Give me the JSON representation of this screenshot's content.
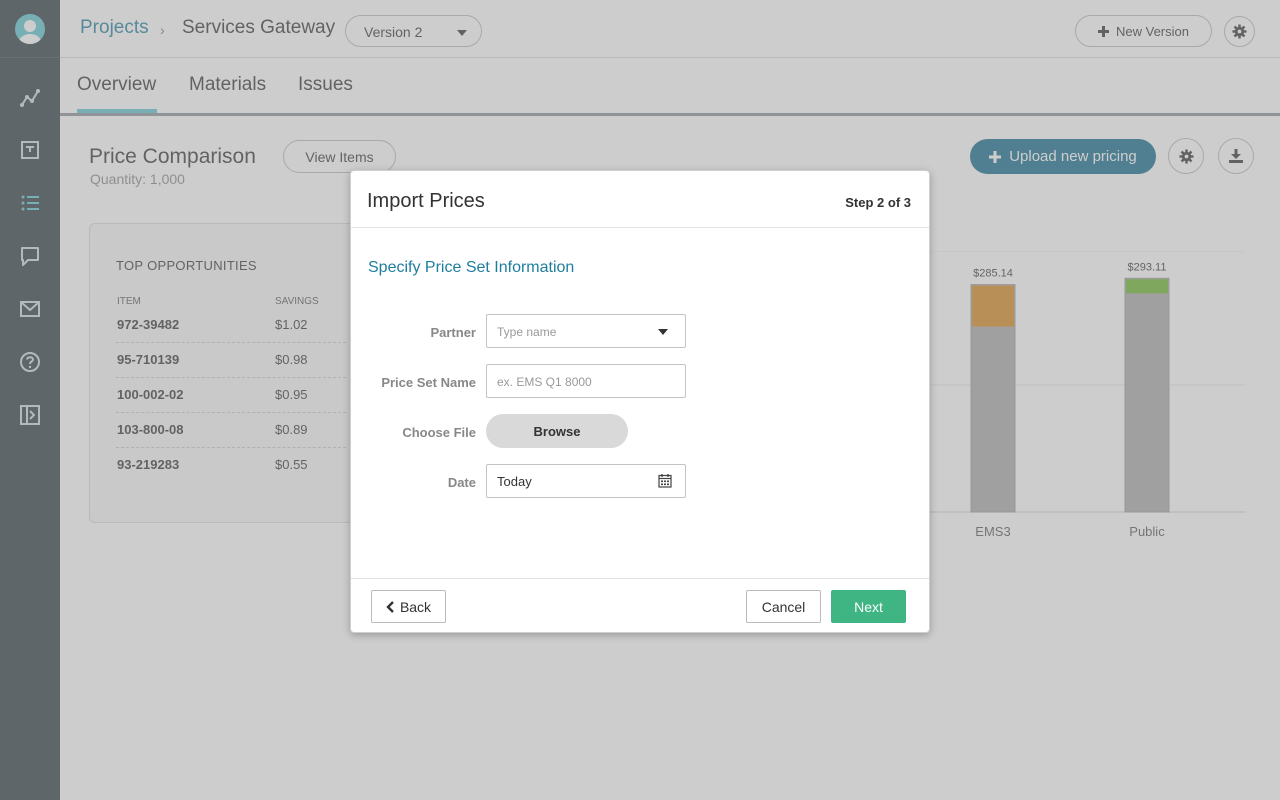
{
  "header": {
    "projects_label": "Projects",
    "separator": "›",
    "current_project": "Services Gateway",
    "version_select": "Version 2",
    "new_version_label": "New Version"
  },
  "tabs": [
    {
      "label": "Overview",
      "active": true
    },
    {
      "label": "Materials",
      "active": false
    },
    {
      "label": "Issues",
      "active": false
    }
  ],
  "sidebar": {
    "items": [
      {
        "icon": "analytics-icon"
      },
      {
        "icon": "document-icon"
      },
      {
        "icon": "list-icon",
        "active": true
      },
      {
        "icon": "chat-icon"
      },
      {
        "icon": "mail-icon"
      },
      {
        "icon": "help-icon"
      },
      {
        "icon": "collapse-icon"
      }
    ]
  },
  "main": {
    "title": "Price Comparison",
    "quantity": "Quantity: 1,000",
    "view_items_label": "View Items",
    "upload_label": "Upload new pricing",
    "opportunities": {
      "title": "TOP OPPORTUNITIES",
      "col_item": "ITEM",
      "col_savings": "SAVINGS",
      "rows": [
        {
          "item": "972-39482",
          "savings": "$1.02"
        },
        {
          "item": "95-710139",
          "savings": "$0.98"
        },
        {
          "item": "100-002-02",
          "savings": "$0.95"
        },
        {
          "item": "103-800-08",
          "savings": "$0.89"
        },
        {
          "item": "93-219283",
          "savings": "$0.55"
        }
      ]
    }
  },
  "chart_data": {
    "type": "bar",
    "categories": [
      "EMS3",
      "Public"
    ],
    "data_labels": [
      "$285.14",
      "$293.11"
    ],
    "values": [
      285.14,
      293.11
    ],
    "highlight_colors": [
      "#d9891f",
      "#6ab72b"
    ],
    "base_color": "#a9a9a9"
  },
  "modal": {
    "title": "Import Prices",
    "step": "Step 2 of 3",
    "subtitle": "Specify Price Set Information",
    "partner_label": "Partner",
    "partner_placeholder": "Type name",
    "price_set_label": "Price Set Name",
    "price_set_placeholder": "ex. EMS Q1 8000",
    "choose_file_label": "Choose File",
    "browse_label": "Browse",
    "date_label": "Date",
    "date_value": "Today",
    "back_label": "Back",
    "cancel_label": "Cancel",
    "next_label": "Next"
  }
}
